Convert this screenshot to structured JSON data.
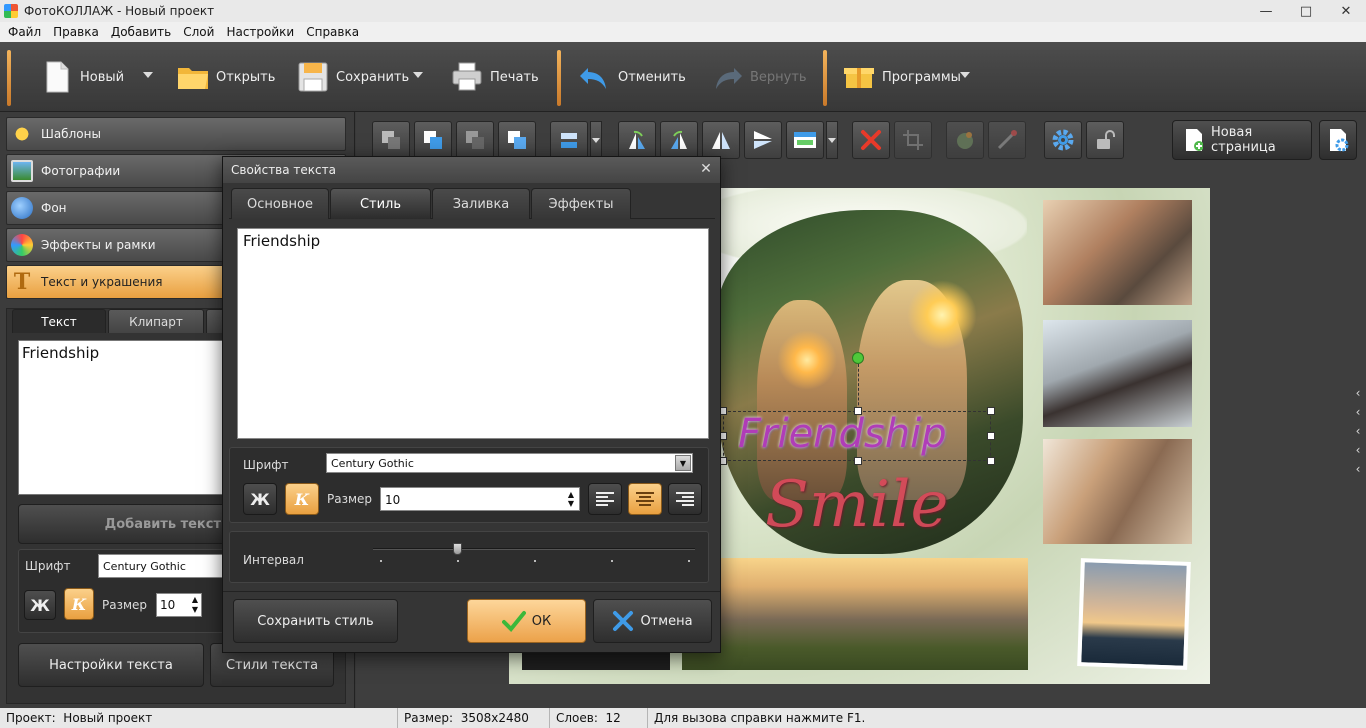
{
  "window": {
    "title": "ФотоКОЛЛАЖ - Новый проект"
  },
  "menu": [
    "Файл",
    "Правка",
    "Добавить",
    "Слой",
    "Настройки",
    "Справка"
  ],
  "toolbar": {
    "new": "Новый",
    "open": "Открыть",
    "save": "Сохранить",
    "print": "Печать",
    "undo": "Отменить",
    "redo": "Вернуть",
    "programs": "Программы"
  },
  "sidebar": {
    "sections": [
      "Шаблоны",
      "Фотографии",
      "Фон",
      "Эффекты и рамки",
      "Текст и украшения"
    ],
    "tabs": [
      "Текст",
      "Клипарт"
    ],
    "text_value": "Friendship",
    "add_text": "Добавить текст",
    "font_label": "Шрифт",
    "font_value": "Century Gothic",
    "bold": "Ж",
    "italic": "К",
    "size_label": "Размер",
    "size_value": "10",
    "text_settings": "Настройки текста",
    "text_styles": "Стили текста"
  },
  "canvas_toolbar": {
    "new_page": "Новая страница"
  },
  "collage": {
    "title_text": "Friendship",
    "sub_text": "Smile"
  },
  "dialog": {
    "title": "Свойства текста",
    "tabs": [
      "Основное",
      "Стиль",
      "Заливка",
      "Эффекты"
    ],
    "active_tab": "Стиль",
    "text_value": "Friendship",
    "font_label": "Шрифт",
    "font_value": "Century Gothic",
    "bold": "Ж",
    "italic": "К",
    "size_label": "Размер",
    "size_value": "10",
    "spacing_label": "Интервал",
    "spacing_value": 0.26,
    "save_style": "Сохранить стиль",
    "ok": "ОК",
    "cancel": "Отмена"
  },
  "status": {
    "project_label": "Проект:",
    "project_value": "Новый проект",
    "size_label": "Размер:",
    "size_value": "3508x2480",
    "layers_label": "Слоев:",
    "layers_value": "12",
    "help": "Для вызова справки нажмите F1."
  },
  "colors": {
    "accent": "#f0a848",
    "panel": "#3c3c3c",
    "dark": "#2d2d2d",
    "title_text": "#b03db8",
    "script_text": "#d84a5a"
  }
}
